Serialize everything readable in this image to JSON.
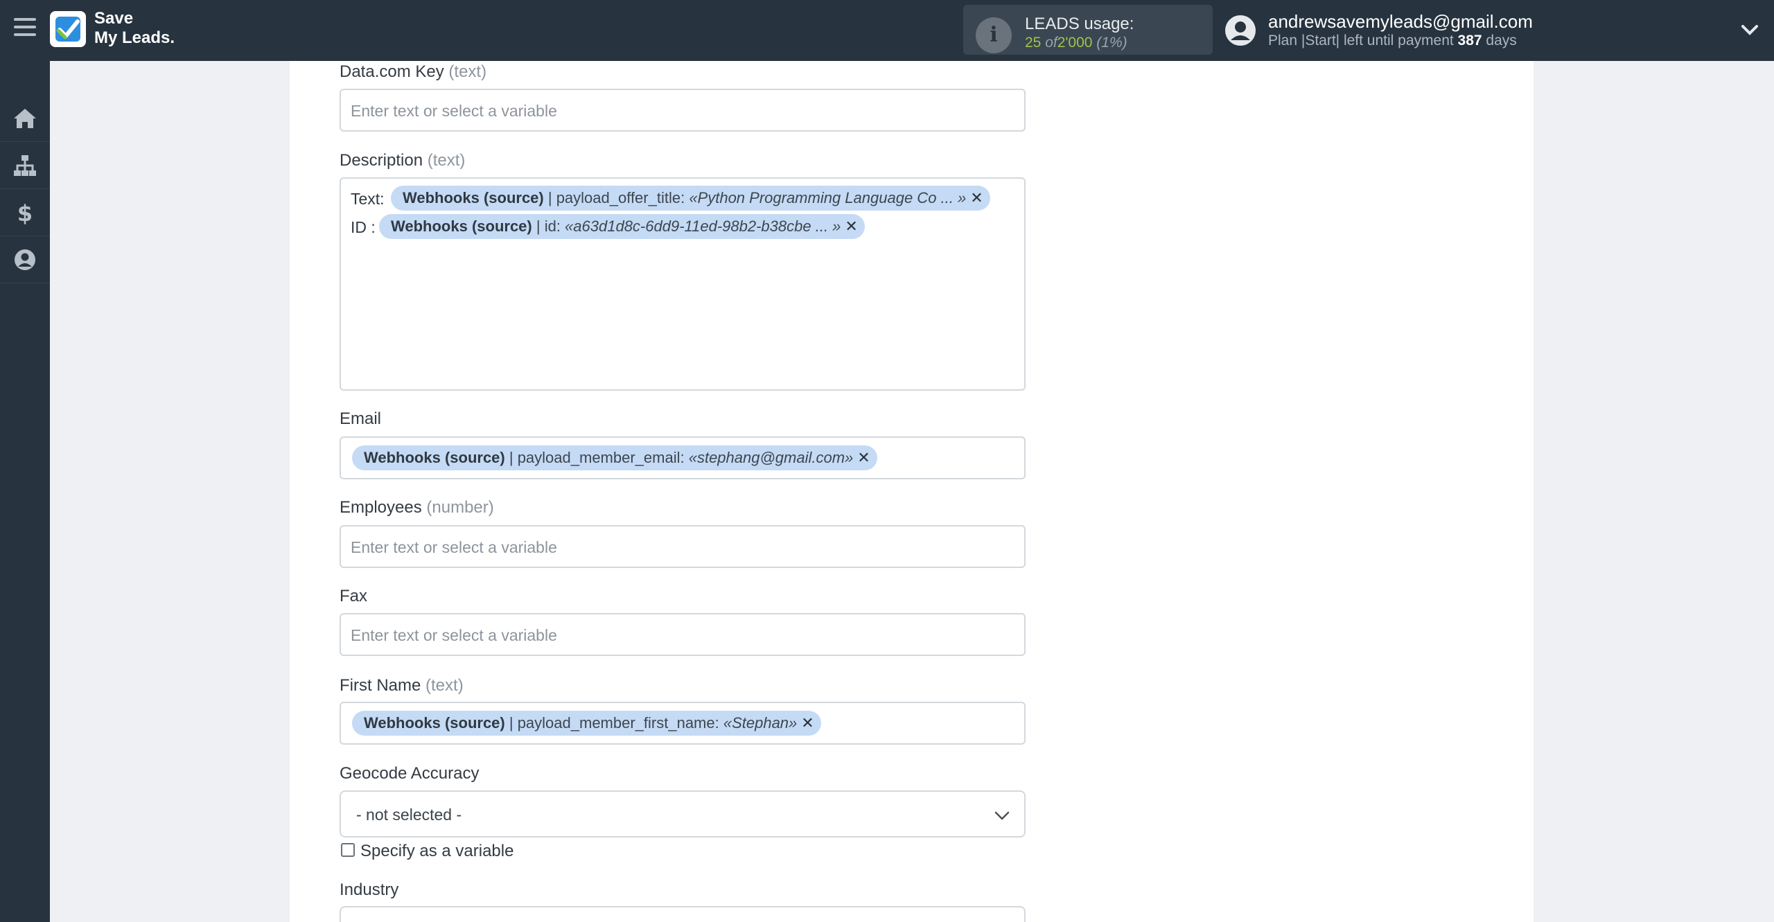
{
  "header": {
    "logo_line1": "Save",
    "logo_line2": "My Leads.",
    "usage_label": "LEADS usage:",
    "usage_used": "25",
    "usage_of": "of",
    "usage_total": "2'000",
    "usage_percent": "(1%)",
    "user_email": "andrewsavemyleads@gmail.com",
    "plan_prefix": "Plan |Start| left until payment ",
    "plan_days": "387",
    "plan_suffix": " days"
  },
  "sidebar": {
    "items": [
      "home-icon",
      "sitemap-icon",
      "dollar-icon",
      "user-icon"
    ]
  },
  "form": {
    "placeholder": "Enter text or select a variable",
    "datacom_key": {
      "label": "Data.com Key",
      "type": "(text)"
    },
    "description": {
      "label": "Description",
      "type": "(text)",
      "rows": [
        {
          "prefix": "Text:",
          "source": "Webhooks (source)",
          "field": " | payload_offer_title: ",
          "value": "«Python Programming Language Co ... »"
        },
        {
          "prefix": "ID :",
          "source": "Webhooks (source)",
          "field": " | id: ",
          "value": "«a63d1d8c-6dd9-11ed-98b2-b38cbe ... »"
        }
      ]
    },
    "email": {
      "label": "Email",
      "source": "Webhooks (source)",
      "field": " | payload_member_email: ",
      "value": "«stephang@gmail.com»"
    },
    "employees": {
      "label": "Employees",
      "type": "(number)"
    },
    "fax": {
      "label": "Fax"
    },
    "first_name": {
      "label": "First Name",
      "type": "(text)",
      "source": "Webhooks (source)",
      "field": " | payload_member_first_name: ",
      "value": "«Stephan»"
    },
    "geocode": {
      "label": "Geocode Accuracy",
      "selected": "- not selected -",
      "checkbox_label": "Specify as a variable"
    },
    "industry": {
      "label": "Industry"
    }
  },
  "colors": {
    "topbar": "#27333f",
    "chip": "#c5daf4",
    "usage_value": "#9fc34b"
  }
}
